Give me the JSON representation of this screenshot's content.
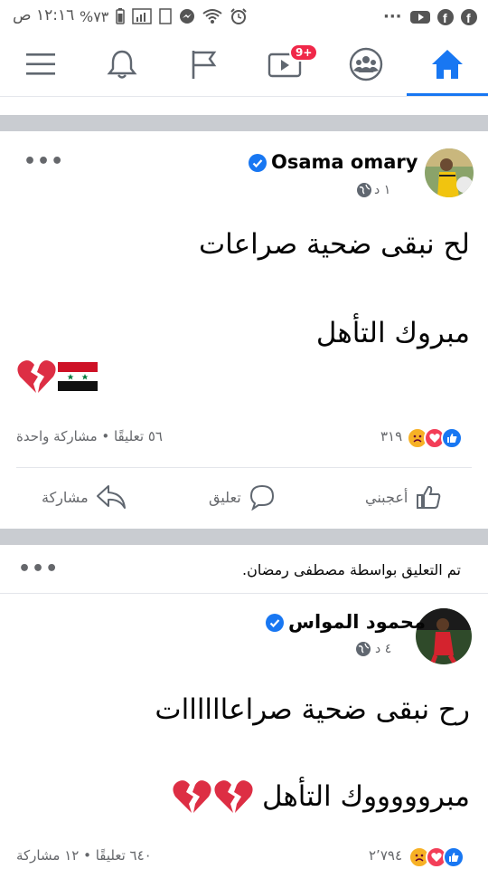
{
  "status_bar": {
    "time": "١٢:١٦ ص",
    "battery": "%٧٣"
  },
  "top_nav": {
    "items": [
      {
        "name": "menu"
      },
      {
        "name": "notifications"
      },
      {
        "name": "pages"
      },
      {
        "name": "watch",
        "badge": "9+"
      },
      {
        "name": "groups"
      },
      {
        "name": "home",
        "active": true
      }
    ]
  },
  "posts": [
    {
      "author": "Osama omary",
      "time": "١ د",
      "lines": [
        "لح نبقى ضحية صراعات",
        "مبروك التأهل"
      ],
      "emojis": [
        "🇸🇾",
        "💔"
      ],
      "reactions_count": "٣١٩",
      "comments_shares": "٥٦ تعليقًا • مشاركة واحدة",
      "actions": {
        "like": "أعجبني",
        "comment": "تعليق",
        "share": "مشاركة"
      }
    },
    {
      "note": "تم التعليق بواسطة مصطفى رمضان.",
      "author": "محمود المواس",
      "time": "٤ د",
      "lines": [
        "رح نبقى ضحية صراعاااااات",
        "مبروووووك التأهل"
      ],
      "emojis": [
        "💔",
        "💔"
      ],
      "reactions_count": "٢٬٧٩٤",
      "comments_shares": "٦٤٠ تعليقًا • ١٢ مشاركة"
    }
  ],
  "more_label": "•••"
}
